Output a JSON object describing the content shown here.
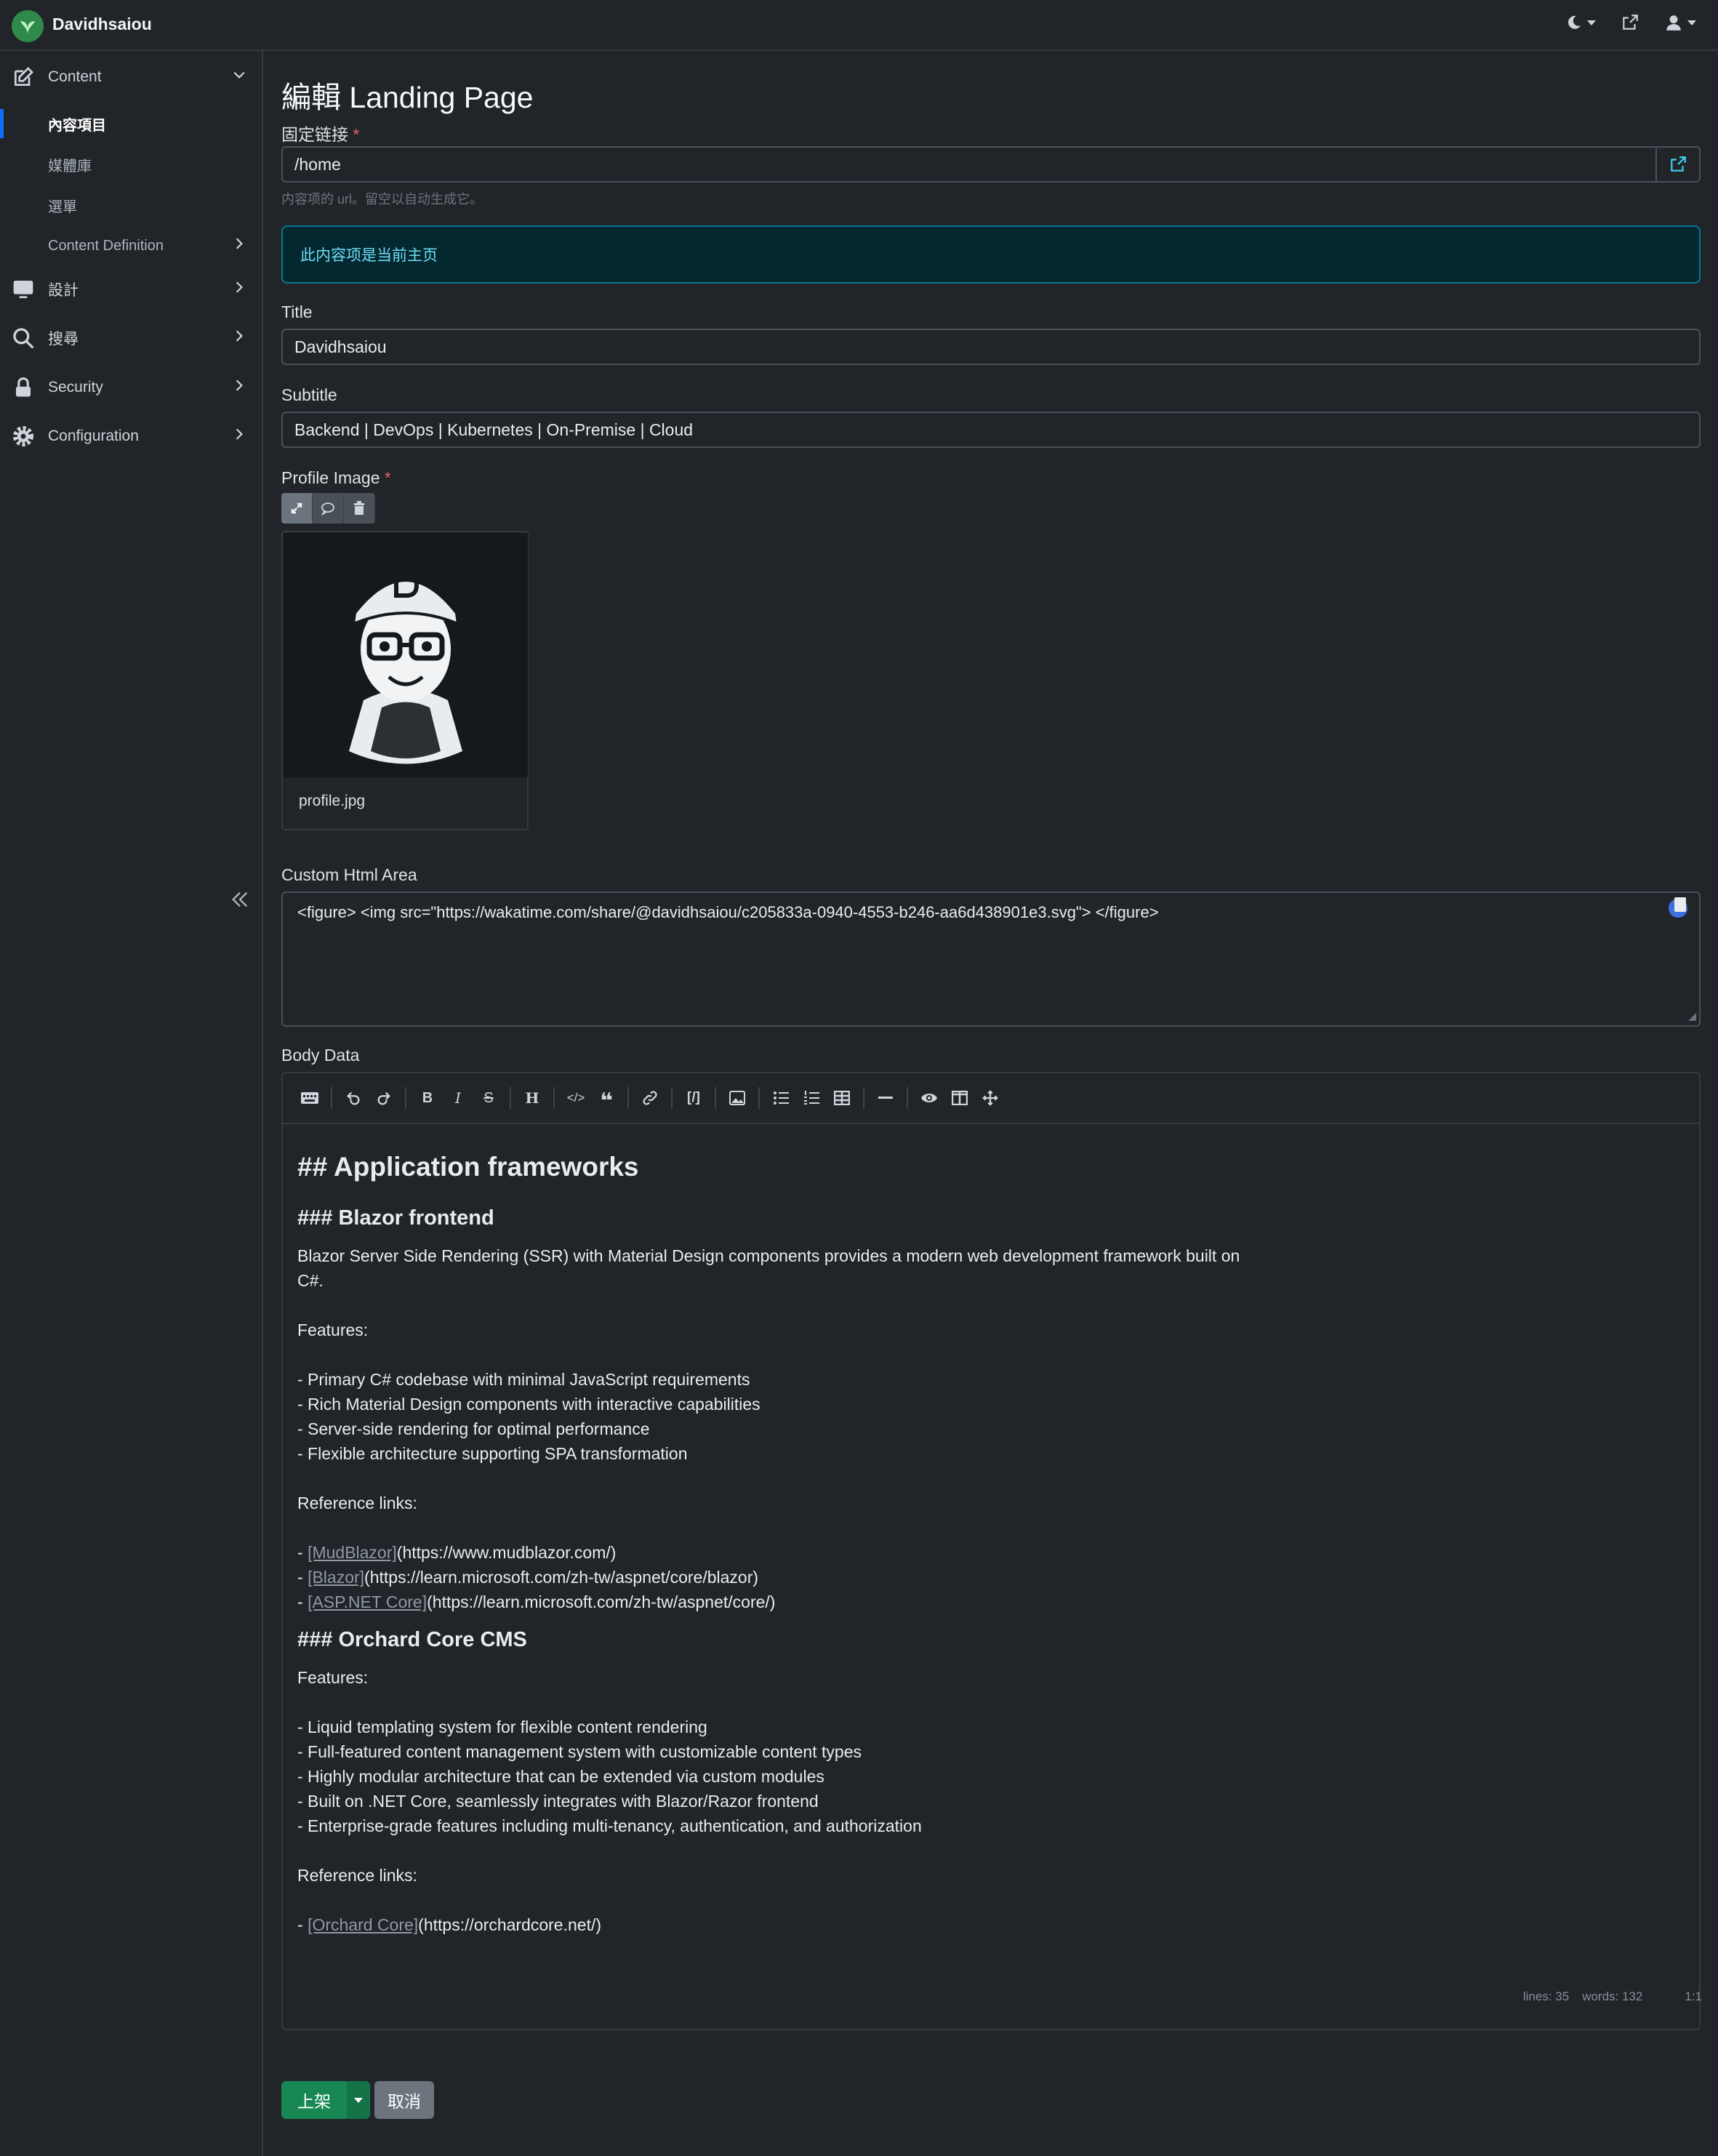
{
  "app": {
    "brand": "Davidhsaiou",
    "icons": [
      "theme-toggle-icon",
      "external-link-icon",
      "user-icon"
    ]
  },
  "sidebar": {
    "sections": [
      {
        "label": "Content",
        "icon": "edit-icon",
        "expanded": true
      },
      {
        "label": "設計",
        "icon": "monitor-icon"
      },
      {
        "label": "搜尋",
        "icon": "search-icon"
      },
      {
        "label": "Security",
        "icon": "lock-icon"
      },
      {
        "label": "Configuration",
        "icon": "gear-icon"
      }
    ],
    "content_items": [
      {
        "label": "內容項目",
        "active": true
      },
      {
        "label": "媒體庫"
      },
      {
        "label": "選單"
      },
      {
        "label": "Content Definition"
      }
    ]
  },
  "page": {
    "title": "編輯 Landing Page",
    "permalink": {
      "label": "固定链接",
      "required_mark": "*",
      "value": "/home",
      "hint": "内容项的 url。留空以自动生成它。"
    },
    "alert": "此内容项是当前主页",
    "title_field": {
      "label": "Title",
      "value": "Davidhsaiou"
    },
    "subtitle_field": {
      "label": "Subtitle",
      "value": "Backend | DevOps | Kubernetes | On-Premise | Cloud"
    },
    "profile_image": {
      "label": "Profile Image",
      "required_mark": "*",
      "filename": "profile.jpg",
      "toolbar": [
        "crop-icon",
        "comment-icon",
        "trash-icon"
      ]
    },
    "custom_html": {
      "label": "Custom Html Area",
      "value": "<figure> <img src=\"https://wakatime.com/share/@davidhsaiou/c205833a-0940-4553-b246-aa6d438901e3.svg\"> </figure>"
    },
    "body": {
      "label": "Body Data",
      "lines": {
        "h2": "## Application frameworks",
        "h3a": "### Blazor frontend",
        "p1a": "Blazor Server Side Rendering (SSR) with Material Design components provides a modern web development framework built on",
        "p1b": "C#.",
        "features1": "Features:",
        "f1": "- Primary C# codebase with minimal JavaScript requirements",
        "f2": "- Rich Material Design components with interactive capabilities",
        "f3": "- Server-side rendering for optimal performance",
        "f4": "- Flexible architecture supporting SPA transformation",
        "ref1": "Reference links:",
        "l1_link": "[MudBlazor]",
        "l1_url": "(https://www.mudblazor.com/)",
        "l2_link": "[Blazor]",
        "l2_url": "(https://learn.microsoft.com/zh-tw/aspnet/core/blazor)",
        "l3_link": "[ASP.NET Core]",
        "l3_url": "(https://learn.microsoft.com/zh-tw/aspnet/core/)",
        "h3b": "### Orchard Core CMS",
        "features2": "Features:",
        "g1": "- Liquid templating system for flexible content rendering",
        "g2": "- Full-featured content management system with customizable content types",
        "g3": "- Highly modular architecture that can be extended via custom modules",
        "g4": "- Built on .NET Core, seamlessly integrates with Blazor/Razor frontend",
        "g5": "- Enterprise-grade features including multi-tenancy, authentication, and authorization",
        "ref2": "Reference links:",
        "l4_link": "[Orchard Core]",
        "l4_url": "(https://orchardcore.net/)",
        "dash": "- "
      },
      "status": {
        "lines": "lines: 35",
        "words": "words: 132",
        "cursor": "1:1"
      }
    },
    "buttons": {
      "publish": "上架",
      "cancel": "取消"
    }
  }
}
